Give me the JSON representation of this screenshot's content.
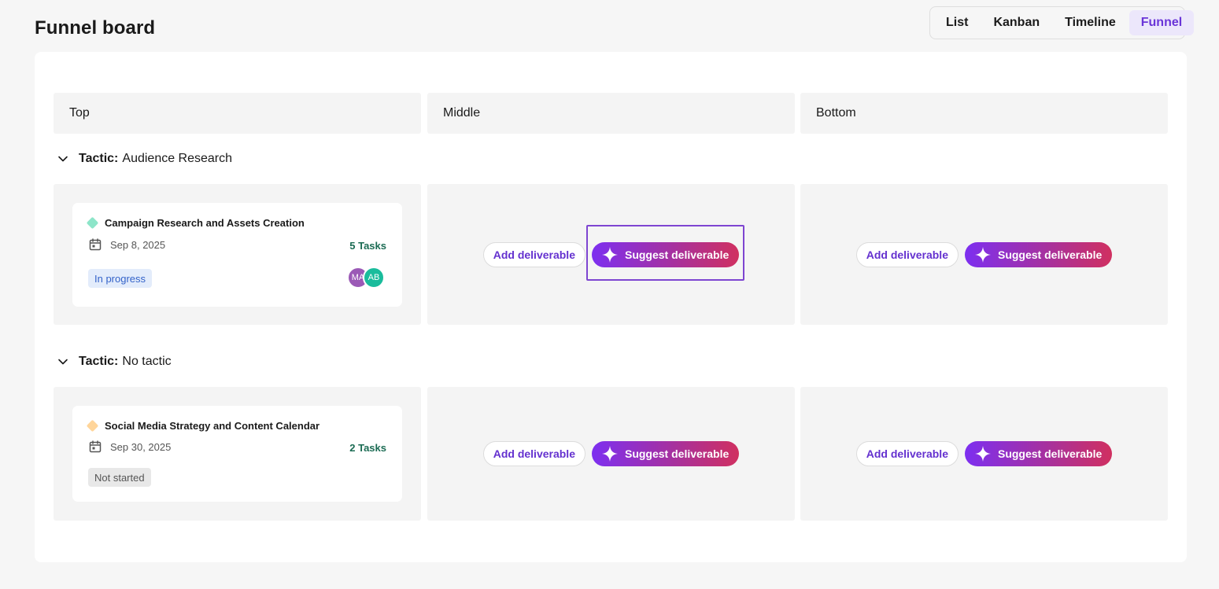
{
  "header": {
    "title": "Funnel board"
  },
  "view_switcher": {
    "tabs": [
      {
        "label": "List",
        "active": false
      },
      {
        "label": "Kanban",
        "active": false
      },
      {
        "label": "Timeline",
        "active": false
      },
      {
        "label": "Funnel",
        "active": true
      }
    ]
  },
  "columns": [
    "Top",
    "Middle",
    "Bottom"
  ],
  "tactic_prefix": "Tactic:",
  "tactics": [
    {
      "name": "Audience Research",
      "card": {
        "title": "Campaign Research and Assets Creation",
        "date": "Sep 8, 2025",
        "tasks": "5 Tasks",
        "status": "In progress",
        "diamond_color": "#8de5c9",
        "avatars": [
          {
            "initials": "MA",
            "color": "#9b59b6"
          },
          {
            "initials": "AB",
            "color": "#1abc9c"
          }
        ]
      }
    },
    {
      "name": "No tactic",
      "card": {
        "title": "Social Media Strategy and Content Calendar",
        "date": "Sep 30, 2025",
        "tasks": "2 Tasks",
        "status": "Not started",
        "diamond_color": "#ffd59a",
        "avatars": []
      }
    }
  ],
  "actions": {
    "add_label": "Add deliverable",
    "suggest_label": "Suggest deliverable"
  },
  "colors": {
    "accent": "#6a35d8",
    "tasks_green": "#1b6b53",
    "status_progress": "#3463c9"
  }
}
